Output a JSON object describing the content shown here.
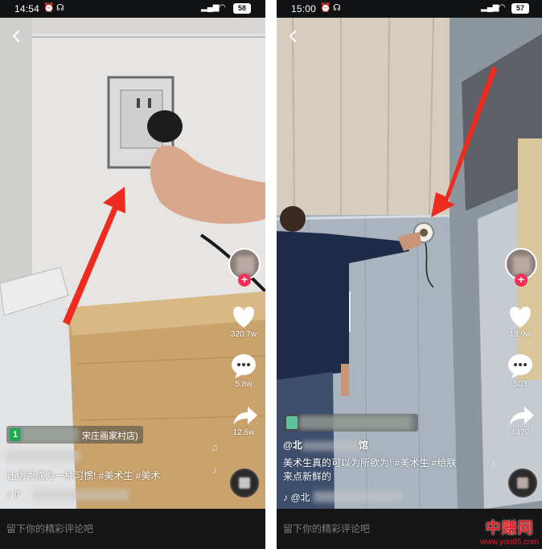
{
  "left": {
    "status_time": "14:54",
    "battery": "58",
    "counts": {
      "likes": "320.7w",
      "comments": "5.8w",
      "shares": "12.6w"
    },
    "location_tag": "宋庄画家村店)",
    "caption": "让优秀成为一种习惯! #美术生 #美术",
    "music_prefix": "If",
    "comment_placeholder": "留下你的精彩评论吧"
  },
  "right": {
    "status_time": "15:00",
    "battery": "57",
    "counts": {
      "likes": "13.9w",
      "comments": "503",
      "shares": "1479"
    },
    "author": "@北",
    "author_suffix": "馆",
    "caption_line1": "美术生真的可以为所欲为! #美术生 #给朕",
    "caption_line2": "来点新鲜的",
    "music_prefix": "@北",
    "comment_placeholder": "留下你的精彩评论吧"
  },
  "watermark": {
    "brand": "中赚网",
    "url": "www.you85.com"
  },
  "colors": {
    "accent_red": "#e3202a",
    "like_pink": "#fe2c55",
    "tag_green": "#1fa84f"
  },
  "icons": [
    "back-arrow-icon",
    "alarm-icon",
    "wifi-icon",
    "signal-icon",
    "heart-icon",
    "comment-icon",
    "share-icon",
    "music-note-icon",
    "tiktok-icon"
  ]
}
